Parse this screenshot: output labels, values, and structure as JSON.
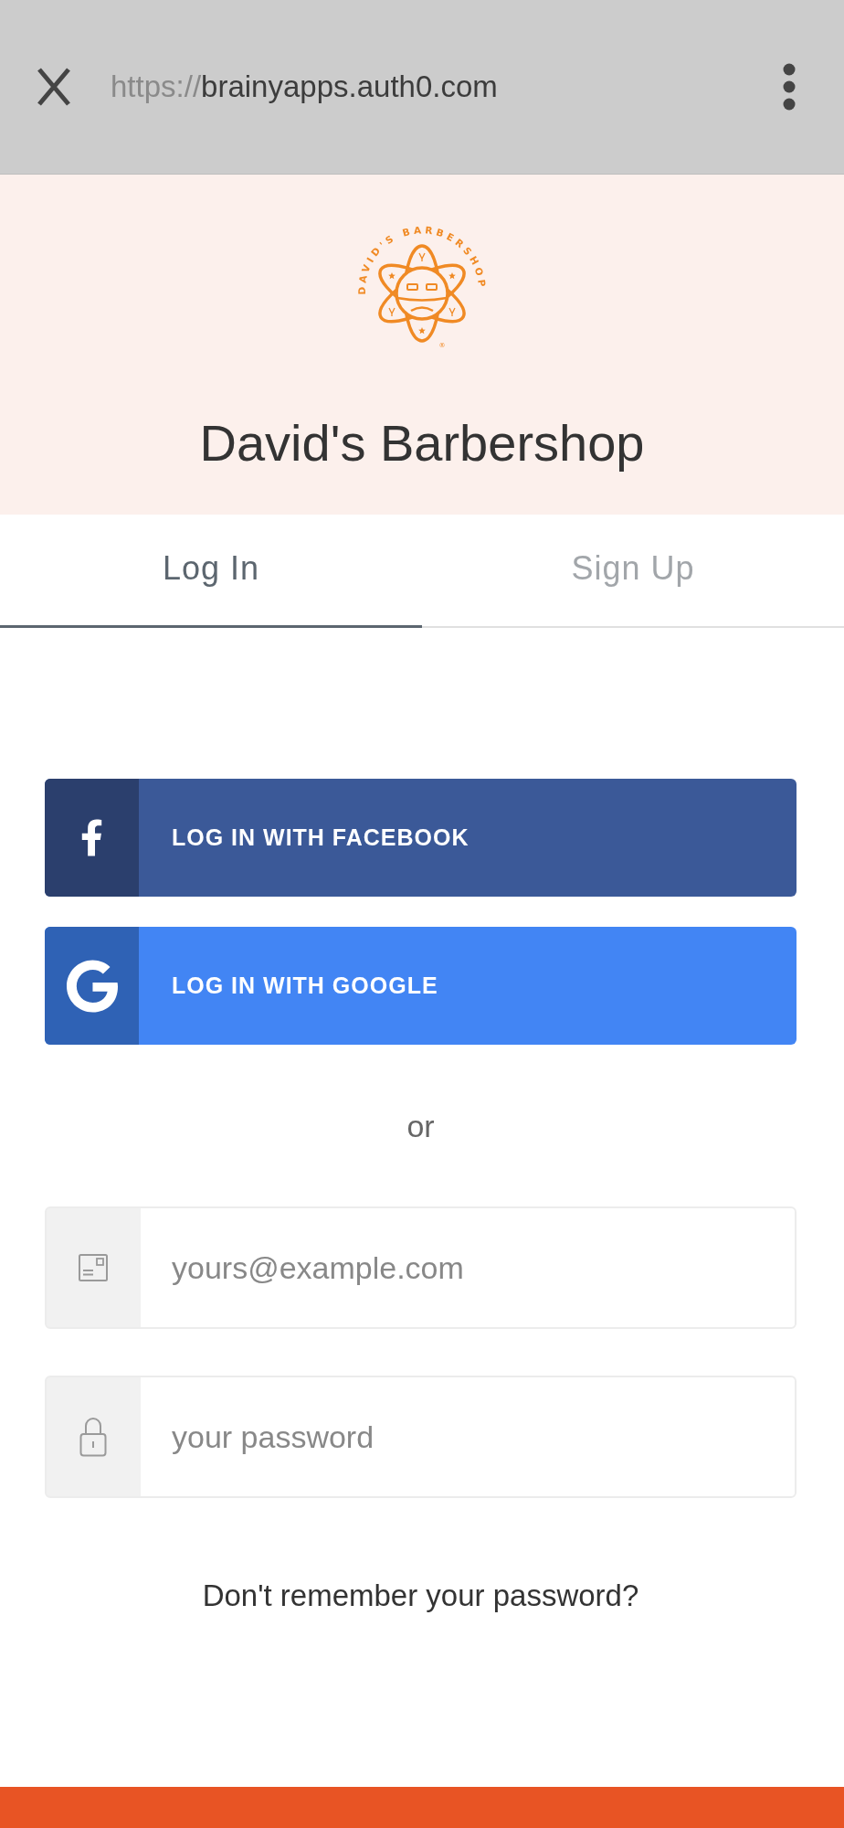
{
  "browser_bar": {
    "url": {
      "scheme": "https://",
      "host": "brainyapps.auth0.com"
    }
  },
  "header": {
    "logo": {
      "text": "DAVID'S BARBERSHOP",
      "mark": "®"
    },
    "title": "David's Barbershop"
  },
  "tabs": [
    {
      "label": "Log In",
      "selected": true
    },
    {
      "label": "Sign Up",
      "selected": false
    }
  ],
  "social_buttons": [
    {
      "kind": "facebook",
      "label": "LOG IN WITH FACEBOOK"
    },
    {
      "kind": "google",
      "label": "LOG IN WITH GOOGLE"
    }
  ],
  "separator": "or",
  "fields": [
    {
      "kind": "email",
      "placeholder": "yours@example.com"
    },
    {
      "kind": "password",
      "placeholder": "your password"
    }
  ],
  "forgot_password_link": "Don't remember your password?"
}
